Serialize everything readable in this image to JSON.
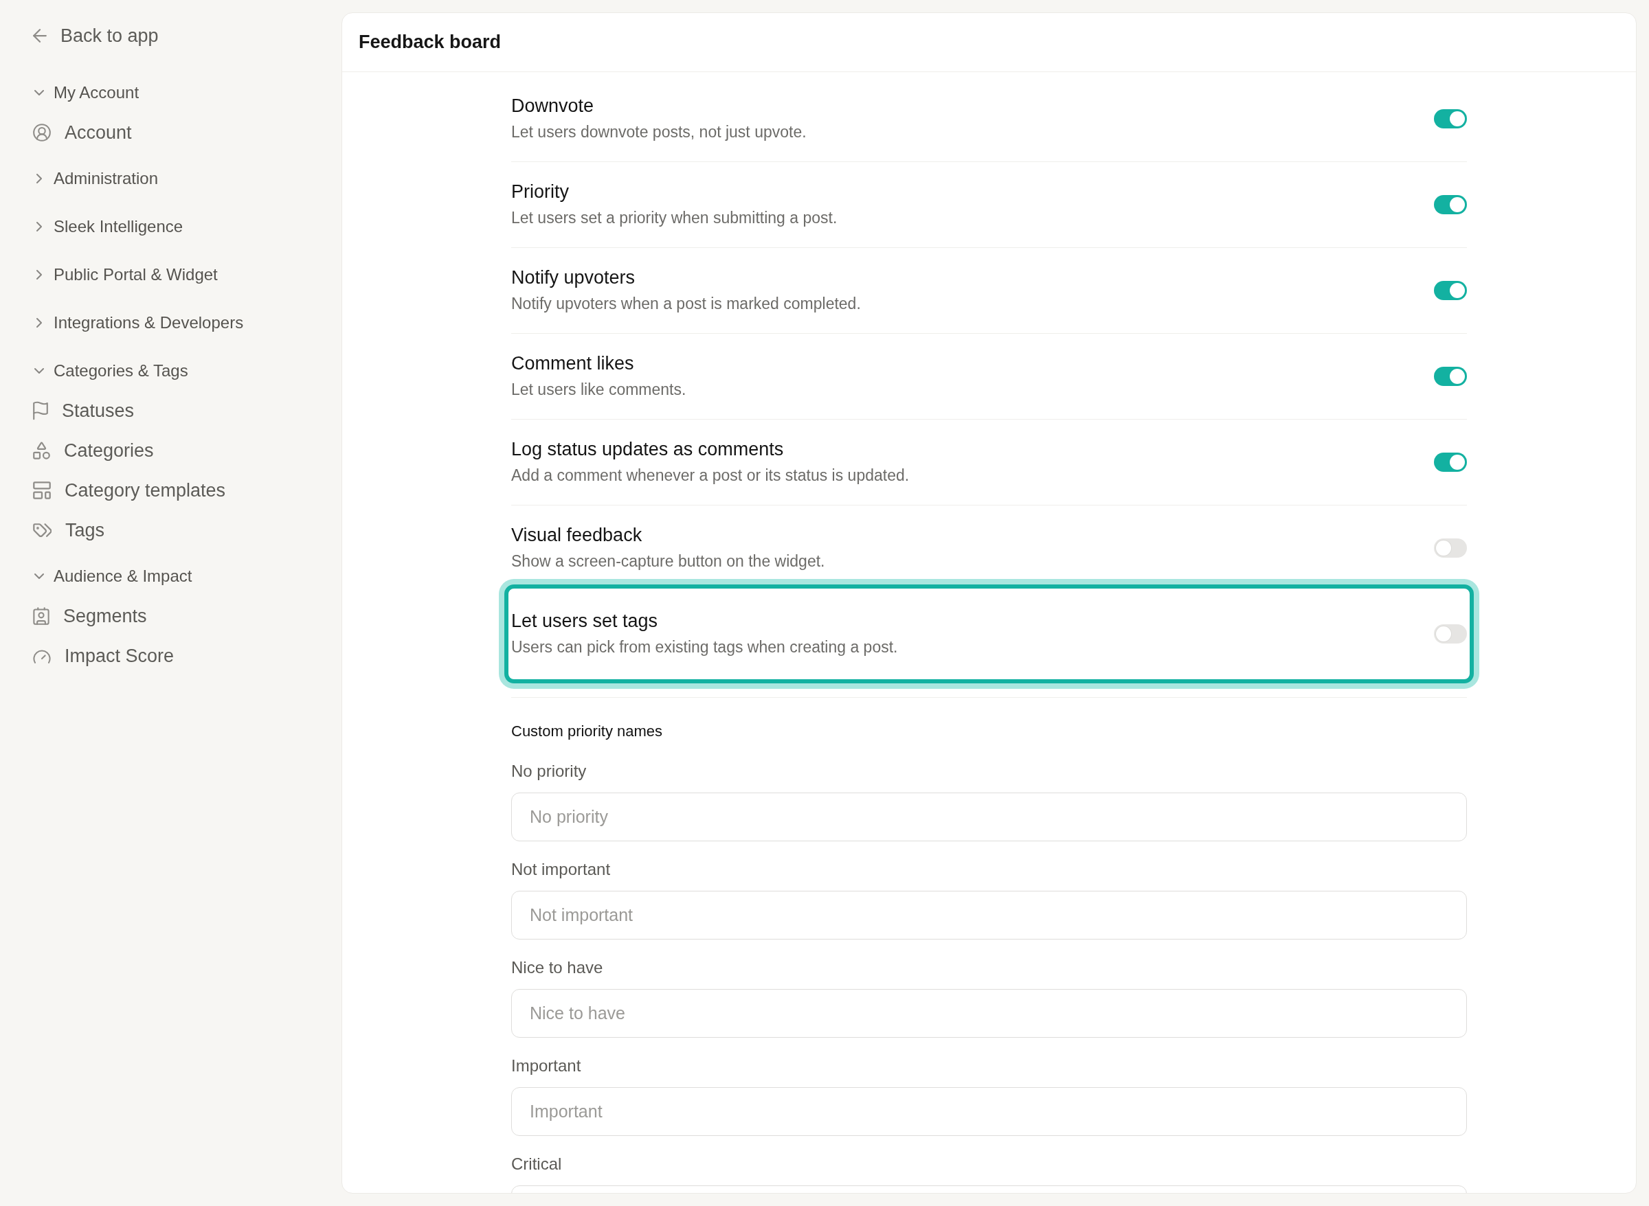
{
  "sidebar": {
    "back_link": "Back to app",
    "groups": [
      {
        "label": "My Account",
        "expanded": true,
        "items": [
          {
            "label": "Account",
            "selected": false
          }
        ]
      },
      {
        "label": "Administration",
        "expanded": false
      },
      {
        "label": "Sleek Intelligence",
        "expanded": false
      },
      {
        "label": "Public Portal & Widget",
        "expanded": false
      },
      {
        "label": "Integrations & Developers",
        "expanded": false
      },
      {
        "label": "Categories & Tags",
        "expanded": true,
        "items": [
          {
            "label": "Statuses",
            "selected": false
          },
          {
            "label": "Categories",
            "selected": false
          },
          {
            "label": "Category templates",
            "selected": false
          },
          {
            "label": "Tags",
            "selected": false
          }
        ]
      },
      {
        "label": "Audience & Impact",
        "expanded": true,
        "items": [
          {
            "label": "Segments",
            "selected": false
          },
          {
            "label": "Impact Score",
            "selected": false
          }
        ]
      }
    ]
  },
  "main": {
    "title": "Feedback board",
    "settings": [
      {
        "title": "Downvote",
        "description": "Let users downvote posts, not just upvote.",
        "on": true,
        "highlighted": false
      },
      {
        "title": "Priority",
        "description": "Let users set a priority when submitting a post.",
        "on": true,
        "highlighted": false
      },
      {
        "title": "Notify upvoters",
        "description": "Notify upvoters when a post is marked completed.",
        "on": true,
        "highlighted": false
      },
      {
        "title": "Comment likes",
        "description": "Let users like comments.",
        "on": true,
        "highlighted": false
      },
      {
        "title": "Log status updates as comments",
        "description": "Add a comment whenever a post or its status is updated.",
        "on": true,
        "highlighted": false
      },
      {
        "title": "Visual feedback",
        "description": "Show a screen-capture button on the widget.",
        "on": false,
        "highlighted": false
      },
      {
        "title": "Let users set tags",
        "description": "Users can pick from existing tags when creating a post.",
        "on": false,
        "highlighted": true
      }
    ],
    "custom_priority_names": {
      "heading": "Custom priority names",
      "fields": [
        {
          "label": "No priority",
          "placeholder": "No priority"
        },
        {
          "label": "Not important",
          "placeholder": "Not important"
        },
        {
          "label": "Nice to have",
          "placeholder": "Nice to have"
        },
        {
          "label": "Important",
          "placeholder": "Important"
        },
        {
          "label": "Critical"
        }
      ]
    }
  }
}
